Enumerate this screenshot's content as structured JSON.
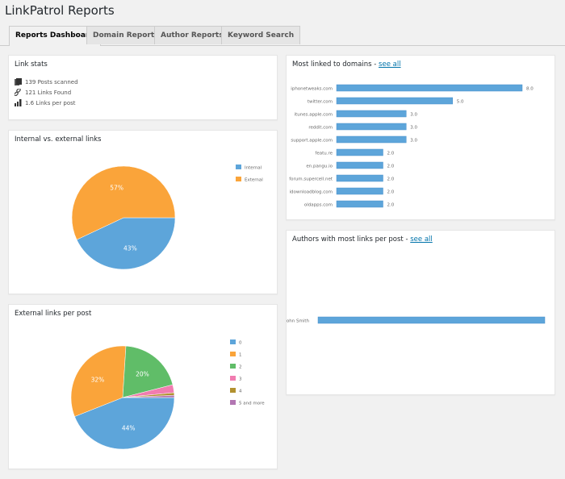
{
  "page": {
    "title": "LinkPatrol Reports"
  },
  "tabs": [
    {
      "label": "Reports Dashboard",
      "active": true
    },
    {
      "label": "Domain Reports",
      "active": false
    },
    {
      "label": "Author Reports",
      "active": false
    },
    {
      "label": "Keyword Search",
      "active": false
    }
  ],
  "link_stats": {
    "title": "Link stats",
    "items": [
      {
        "icon": "posts-icon",
        "text": "139 Posts scanned"
      },
      {
        "icon": "link-icon",
        "text": "121 Links Found"
      },
      {
        "icon": "bar-chart-icon",
        "text": "1.6 Links per post"
      }
    ]
  },
  "domains_card": {
    "title": "Most linked to domains - ",
    "link": "see all"
  },
  "authors_card": {
    "title": "Authors with most links per post - ",
    "link": "see all"
  },
  "internal_card": {
    "title": "Internal vs. external links"
  },
  "external_card": {
    "title": "External links per post"
  },
  "colors": {
    "blue": "#5da5da",
    "orange": "#faa43a",
    "green": "#60bd68",
    "pink": "#f17cb0",
    "brown": "#b2912f",
    "purple": "#b276b2"
  },
  "chart_data": [
    {
      "type": "pie",
      "title": "Internal vs. external links",
      "categories": [
        "Internal",
        "External"
      ],
      "values": [
        43,
        57
      ],
      "labels": [
        "43%",
        "57%"
      ],
      "colors": [
        "#5da5da",
        "#faa43a"
      ],
      "legend": "right"
    },
    {
      "type": "pie",
      "title": "External links per post",
      "categories": [
        "0",
        "1",
        "2",
        "3",
        "4",
        "5 and more"
      ],
      "values": [
        44,
        32,
        20,
        2.5,
        0.8,
        0.7
      ],
      "labels": [
        "44%",
        "32%",
        "20%",
        "",
        "",
        ""
      ],
      "colors": [
        "#5da5da",
        "#faa43a",
        "#60bd68",
        "#f17cb0",
        "#b2912f",
        "#b276b2"
      ],
      "legend": "right"
    },
    {
      "type": "bar",
      "orientation": "horizontal",
      "title": "Most linked to domains",
      "categories": [
        "iphonetweaks.com",
        "twitter.com",
        "itunes.apple.com",
        "reddit.com",
        "support.apple.com",
        "featu.re",
        "en.pangu.io",
        "forum.supercell.net",
        "idownloadblog.com",
        "oldapps.com"
      ],
      "values": [
        8.0,
        5.0,
        3.0,
        3.0,
        3.0,
        2.0,
        2.0,
        2.0,
        2.0,
        2.0
      ],
      "value_labels": [
        "8.0",
        "5.0",
        "3.0",
        "3.0",
        "3.0",
        "2.0",
        "2.0",
        "2.0",
        "2.0",
        "2.0"
      ],
      "color": "#5da5da"
    },
    {
      "type": "bar",
      "orientation": "horizontal",
      "title": "Authors with most links per post",
      "categories": [
        "John Smith"
      ],
      "values": [
        1
      ],
      "color": "#5da5da"
    }
  ]
}
